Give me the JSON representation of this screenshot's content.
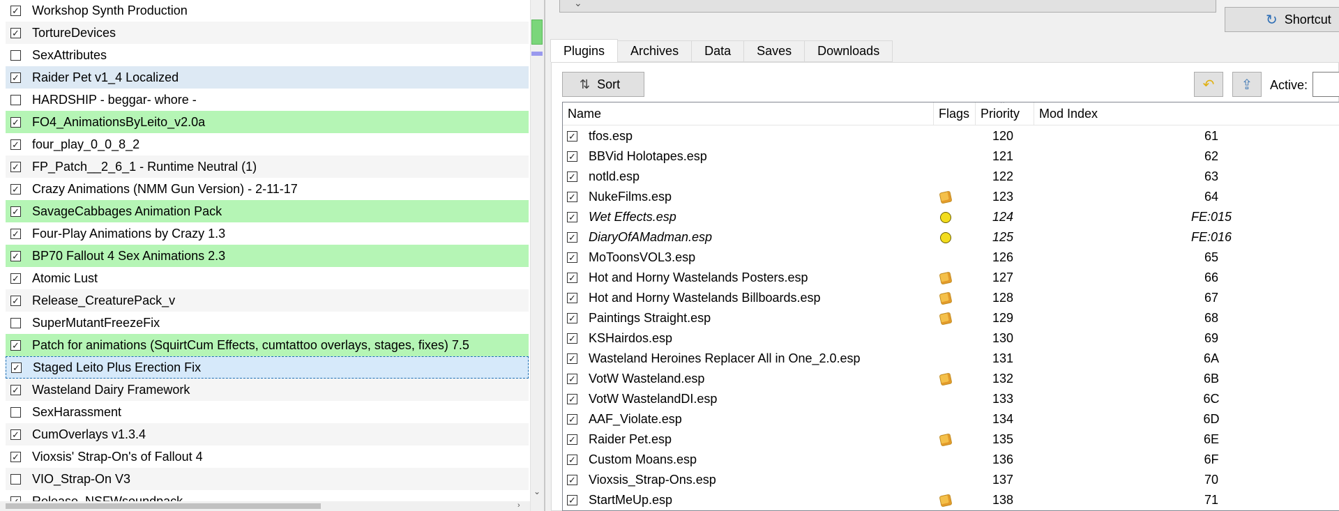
{
  "mod_list": [
    {
      "name": "Workshop Synth Production",
      "checked": true,
      "highlight": "none"
    },
    {
      "name": "TortureDevices",
      "checked": true,
      "highlight": "alt"
    },
    {
      "name": "SexAttributes",
      "checked": false,
      "highlight": "none"
    },
    {
      "name": "Raider Pet v1_4 Localized",
      "checked": true,
      "highlight": "blue"
    },
    {
      "name": "HARDSHIP - beggar- whore -",
      "checked": false,
      "highlight": "none"
    },
    {
      "name": "FO4_AnimationsByLeito_v2.0a",
      "checked": true,
      "highlight": "green"
    },
    {
      "name": "four_play_0_0_8_2",
      "checked": true,
      "highlight": "none"
    },
    {
      "name": "FP_Patch__2_6_1 - Runtime Neutral (1)",
      "checked": true,
      "highlight": "alt"
    },
    {
      "name": "Crazy Animations (NMM Gun Version) - 2-11-17",
      "checked": true,
      "highlight": "none"
    },
    {
      "name": "SavageCabbages Animation Pack",
      "checked": true,
      "highlight": "green"
    },
    {
      "name": "Four-Play Animations by Crazy 1.3",
      "checked": true,
      "highlight": "none"
    },
    {
      "name": "BP70 Fallout 4 Sex Animations 2.3",
      "checked": true,
      "highlight": "green"
    },
    {
      "name": "Atomic Lust",
      "checked": true,
      "highlight": "none"
    },
    {
      "name": "Release_CreaturePack_v",
      "checked": true,
      "highlight": "alt"
    },
    {
      "name": "SuperMutantFreezeFix",
      "checked": false,
      "highlight": "none"
    },
    {
      "name": "Patch for animations (SquirtCum Effects, cumtattoo overlays, stages, fixes) 7.5",
      "checked": true,
      "highlight": "green"
    },
    {
      "name": "Staged Leito Plus Erection Fix",
      "checked": true,
      "highlight": "selected"
    },
    {
      "name": "Wasteland Dairy Framework",
      "checked": true,
      "highlight": "alt"
    },
    {
      "name": "SexHarassment",
      "checked": false,
      "highlight": "none"
    },
    {
      "name": "CumOverlays v1.3.4",
      "checked": true,
      "highlight": "alt"
    },
    {
      "name": "Vioxsis' Strap-On's of Fallout 4",
      "checked": true,
      "highlight": "none"
    },
    {
      "name": "VIO_Strap-On V3",
      "checked": false,
      "highlight": "alt"
    },
    {
      "name": "Release_NSFWsoundpack",
      "checked": true,
      "highlight": "none"
    }
  ],
  "toolbar": {
    "shortcut_label": "Shortcut",
    "sort_label": "Sort",
    "active_label": "Active:"
  },
  "tabs": [
    {
      "label": "Plugins",
      "active": true
    },
    {
      "label": "Archives",
      "active": false
    },
    {
      "label": "Data",
      "active": false
    },
    {
      "label": "Saves",
      "active": false
    },
    {
      "label": "Downloads",
      "active": false
    }
  ],
  "plugin_table": {
    "headers": {
      "name": "Name",
      "flags": "Flags",
      "priority": "Priority",
      "mod_index": "Mod Index"
    },
    "rows": [
      {
        "name": "tfos.esp",
        "flag": "",
        "priority": "120",
        "index": "61",
        "italic": false
      },
      {
        "name": "BBVid Holotapes.esp",
        "flag": "",
        "priority": "121",
        "index": "62",
        "italic": false
      },
      {
        "name": "notld.esp",
        "flag": "",
        "priority": "122",
        "index": "63",
        "italic": false
      },
      {
        "name": "NukeFilms.esp",
        "flag": "archive-box-icon",
        "priority": "123",
        "index": "64",
        "italic": false
      },
      {
        "name": "Wet Effects.esp",
        "flag": "light-plugin-icon",
        "priority": "124",
        "index": "FE:015",
        "italic": true
      },
      {
        "name": "DiaryOfAMadman.esp",
        "flag": "light-plugin-icon",
        "priority": "125",
        "index": "FE:016",
        "italic": true
      },
      {
        "name": "MoToonsVOL3.esp",
        "flag": "",
        "priority": "126",
        "index": "65",
        "italic": false
      },
      {
        "name": "Hot and Horny Wastelands Posters.esp",
        "flag": "archive-box-icon",
        "priority": "127",
        "index": "66",
        "italic": false
      },
      {
        "name": "Hot and Horny Wastelands Billboards.esp",
        "flag": "archive-box-icon",
        "priority": "128",
        "index": "67",
        "italic": false
      },
      {
        "name": "Paintings Straight.esp",
        "flag": "archive-box-icon",
        "priority": "129",
        "index": "68",
        "italic": false
      },
      {
        "name": "KSHairdos.esp",
        "flag": "",
        "priority": "130",
        "index": "69",
        "italic": false
      },
      {
        "name": "Wasteland Heroines Replacer All in One_2.0.esp",
        "flag": "",
        "priority": "131",
        "index": "6A",
        "italic": false
      },
      {
        "name": "VotW Wasteland.esp",
        "flag": "archive-box-icon",
        "priority": "132",
        "index": "6B",
        "italic": false
      },
      {
        "name": "VotW WastelandDI.esp",
        "flag": "",
        "priority": "133",
        "index": "6C",
        "italic": false
      },
      {
        "name": "AAF_Violate.esp",
        "flag": "",
        "priority": "134",
        "index": "6D",
        "italic": false
      },
      {
        "name": "Raider Pet.esp",
        "flag": "archive-box-icon",
        "priority": "135",
        "index": "6E",
        "italic": false
      },
      {
        "name": "Custom Moans.esp",
        "flag": "",
        "priority": "136",
        "index": "6F",
        "italic": false
      },
      {
        "name": "Vioxsis_Strap-Ons.esp",
        "flag": "",
        "priority": "137",
        "index": "70",
        "italic": false
      },
      {
        "name": "StartMeUp.esp",
        "flag": "archive-box-icon",
        "priority": "138",
        "index": "71",
        "italic": false
      }
    ]
  },
  "glyphs": {
    "check": "✓",
    "shortcut_icon": "↻",
    "sort_icon": "⇅",
    "undo_icon": "↶",
    "backup_icon": "⇪",
    "scroll_right": "›",
    "scroll_down": "⌄",
    "sort_caret": "^",
    "collapse": "⌄"
  }
}
